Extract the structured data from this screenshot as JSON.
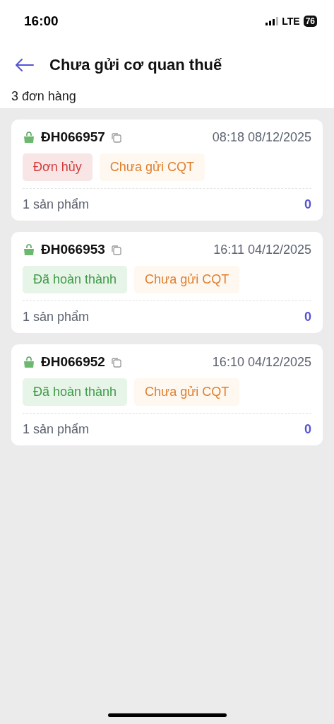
{
  "status_bar": {
    "time": "16:00",
    "network": "LTE",
    "battery": "76"
  },
  "header": {
    "title": "Chưa gửi cơ quan thuế"
  },
  "order_count": "3 đơn hàng",
  "orders": [
    {
      "code": "ĐH066957",
      "datetime": "08:18 08/12/2025",
      "tags": [
        {
          "label": "Đơn hủy",
          "kind": "cancelled"
        },
        {
          "label": "Chưa gửi CQT",
          "kind": "pending"
        }
      ],
      "products": "1 sản phẩm",
      "total": "0"
    },
    {
      "code": "ĐH066953",
      "datetime": "16:11 04/12/2025",
      "tags": [
        {
          "label": "Đã hoàn thành",
          "kind": "completed"
        },
        {
          "label": "Chưa gửi CQT",
          "kind": "pending"
        }
      ],
      "products": "1 sản phẩm",
      "total": "0"
    },
    {
      "code": "ĐH066952",
      "datetime": "16:10 04/12/2025",
      "tags": [
        {
          "label": "Đã hoàn thành",
          "kind": "completed"
        },
        {
          "label": "Chưa gửi CQT",
          "kind": "pending"
        }
      ],
      "products": "1 sản phẩm",
      "total": "0"
    }
  ]
}
